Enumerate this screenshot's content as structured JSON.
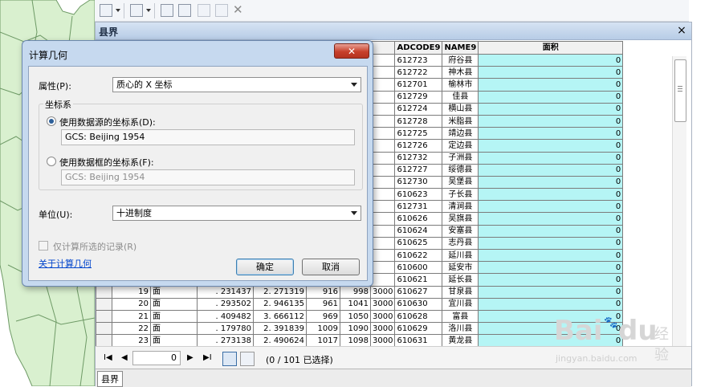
{
  "window": {
    "title": "县界",
    "close_glyph": "×",
    "bottom_tab": "县界"
  },
  "dialog": {
    "title": "计算几何",
    "close_glyph": "✕",
    "property_label": "属性(P):",
    "property_value": "质心的 X 坐标",
    "coord_group": "坐标系",
    "radio_source_label": "使用数据源的坐标系(D):",
    "radio_source_value": "GCS: Beijing 1954",
    "radio_frame_label": "使用数据框的坐标系(F):",
    "radio_frame_value": "GCS: Beijing 1954",
    "units_label": "单位(U):",
    "units_value": "十进制度",
    "selected_only_label": "仅计算所选的记录(R)",
    "about_link": "关于计算几何",
    "ok_label": "确定",
    "cancel_label": "取消"
  },
  "table": {
    "headers": [
      "ADCODE9",
      "NAME9",
      "面积"
    ],
    "top_rows": [
      {
        "code": "612723",
        "name": "府谷县",
        "area": "0"
      },
      {
        "code": "612722",
        "name": "神木县",
        "area": "0"
      },
      {
        "code": "612701",
        "name": "榆林市",
        "area": "0"
      },
      {
        "code": "612729",
        "name": "佳县",
        "area": "0"
      },
      {
        "code": "612724",
        "name": "横山县",
        "area": "0"
      },
      {
        "code": "612728",
        "name": "米脂县",
        "area": "0"
      },
      {
        "code": "612725",
        "name": "靖边县",
        "area": "0"
      },
      {
        "code": "612726",
        "name": "定边县",
        "area": "0"
      },
      {
        "code": "612732",
        "name": "子洲县",
        "area": "0"
      },
      {
        "code": "612727",
        "name": "绥德县",
        "area": "0"
      },
      {
        "code": "612730",
        "name": "吴堡县",
        "area": "0"
      },
      {
        "code": "610623",
        "name": "子长县",
        "area": "0"
      },
      {
        "code": "612731",
        "name": "清涧县",
        "area": "0"
      },
      {
        "code": "610626",
        "name": "吴旗县",
        "area": "0"
      },
      {
        "code": "610624",
        "name": "安塞县",
        "area": "0"
      },
      {
        "code": "610625",
        "name": "志丹县",
        "area": "0"
      },
      {
        "code": "610622",
        "name": "延川县",
        "area": "0"
      },
      {
        "code": "610600",
        "name": "延安市",
        "area": "0"
      },
      {
        "code": "610621",
        "name": "延长县",
        "area": "0"
      }
    ],
    "full_rows": [
      {
        "fid": "19",
        "shape": "面",
        "a": ". 231437",
        "b": "2. 271319",
        "c": "916",
        "d": "998",
        "e": "3000",
        "code": "610627",
        "name": "甘泉县",
        "area": "0"
      },
      {
        "fid": "20",
        "shape": "面",
        "a": ". 293502",
        "b": "2. 946135",
        "c": "961",
        "d": "1041",
        "e": "3000",
        "code": "610630",
        "name": "宜川县",
        "area": "0"
      },
      {
        "fid": "21",
        "shape": "面",
        "a": ". 409482",
        "b": "3. 666112",
        "c": "969",
        "d": "1050",
        "e": "3000",
        "code": "610628",
        "name": "富县",
        "area": "0"
      },
      {
        "fid": "22",
        "shape": "面",
        "a": ". 179780",
        "b": "2. 391839",
        "c": "1009",
        "d": "1090",
        "e": "3000",
        "code": "610629",
        "name": "洛川县",
        "area": "0"
      },
      {
        "fid": "23",
        "shape": "面",
        "a": ". 273138",
        "b": "2. 490624",
        "c": "1017",
        "d": "1098",
        "e": "3000",
        "code": "610631",
        "name": "黄龙县",
        "area": "0"
      }
    ]
  },
  "navigator": {
    "current_record": "0",
    "selection_status": "(0 / 101 已选择)",
    "first_glyph": "I◀",
    "prev_glyph": "◀",
    "next_glyph": "▶",
    "last_glyph": "▶I"
  },
  "watermark": {
    "brand": "Bai",
    "brand2": "du",
    "product": "经验",
    "url": "jingyan.baidu.com"
  },
  "colors": {
    "area_column": "#b5f5f5",
    "title_bar": "#c6d9ef",
    "close_button": "#c7402b",
    "map_fill": "#d9f0cf"
  }
}
